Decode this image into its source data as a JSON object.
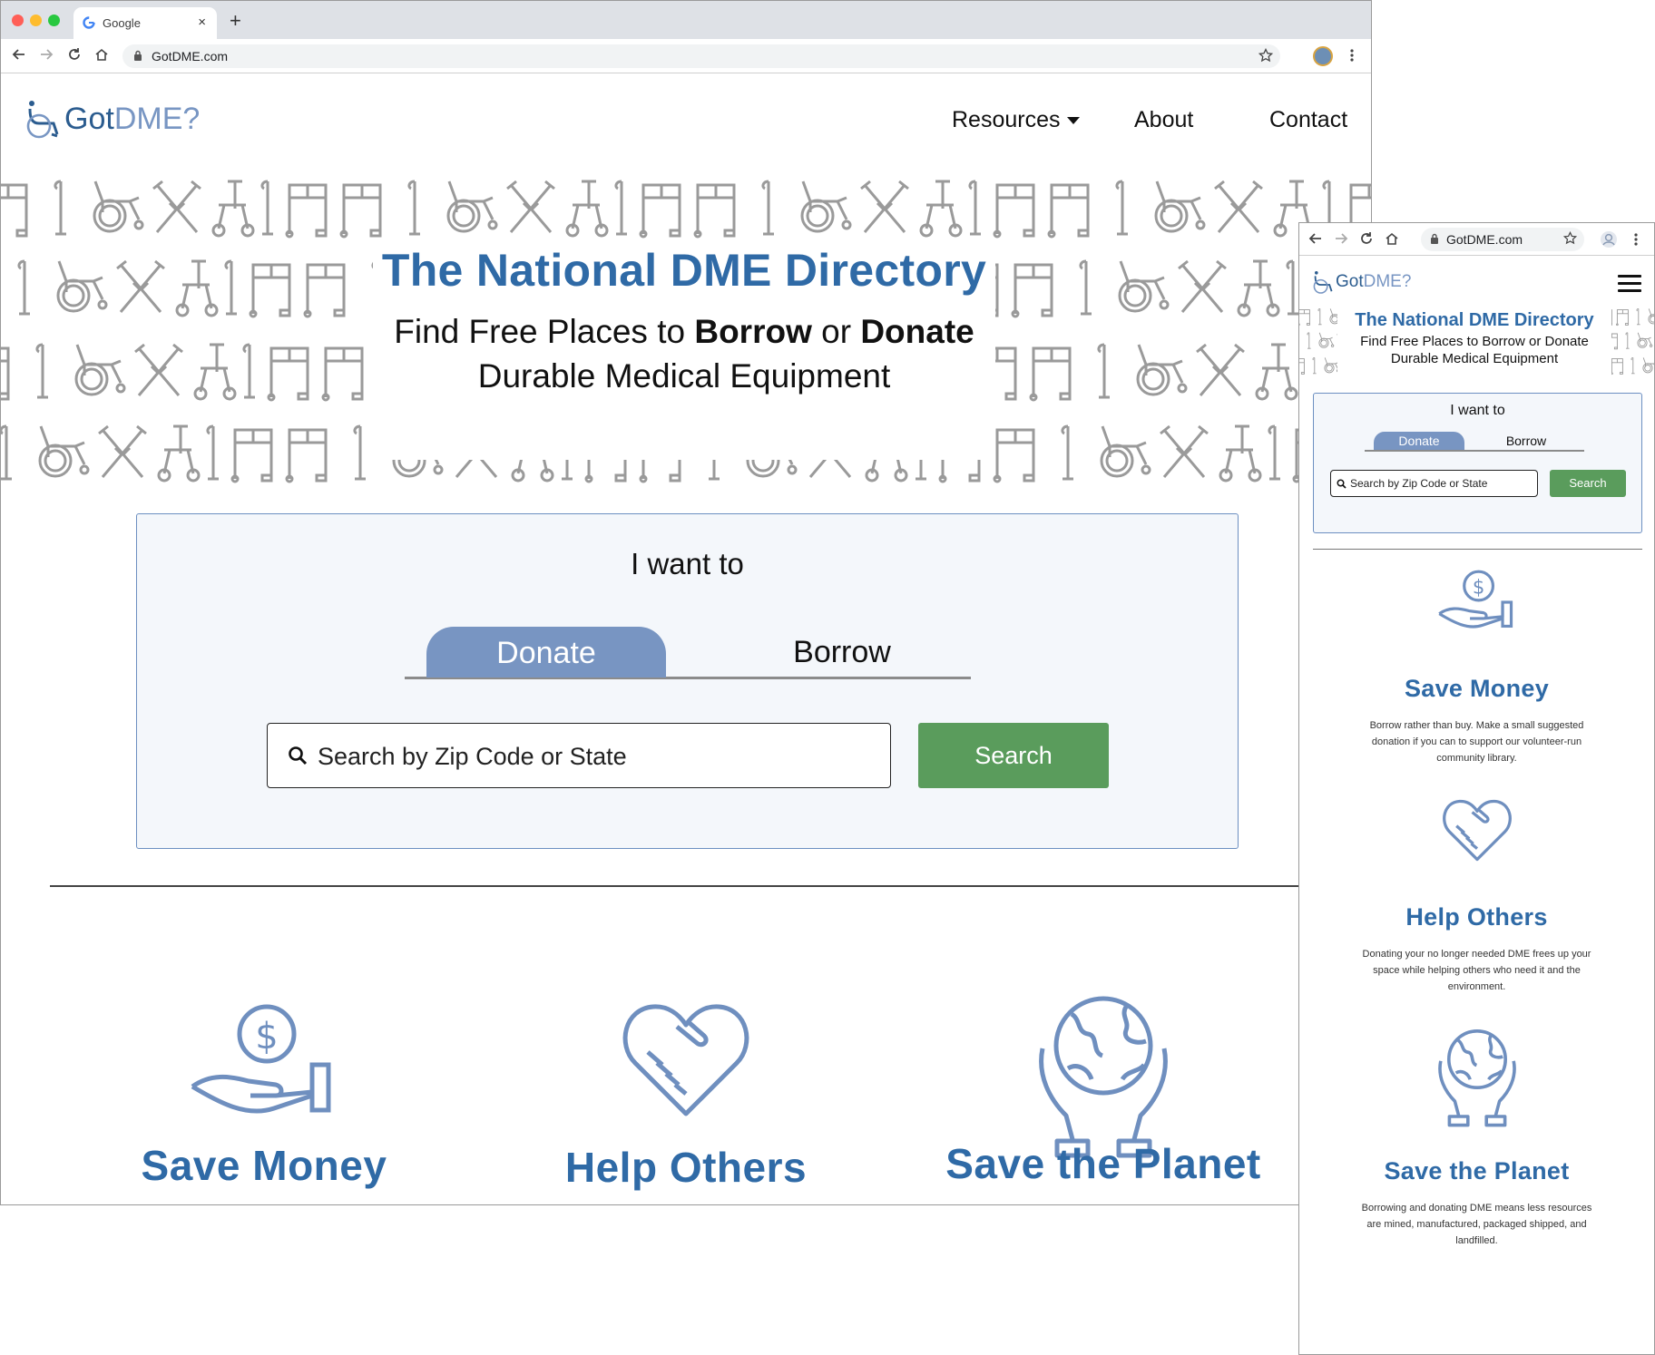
{
  "desktop": {
    "tab_title": "Google",
    "new_tab_label": "+",
    "tab_close_label": "×",
    "url": "GotDME.com",
    "logo": {
      "got": "Got",
      "dme": "DME?"
    },
    "nav": {
      "resources": "Resources",
      "about": "About",
      "contact": "Contact"
    },
    "title": "The National DME Directory",
    "subtitle": {
      "part1": "Find Free Places to ",
      "borrow": "Borrow",
      "or": " or ",
      "donate": "Donate",
      "line2": "Durable Medical Equipment"
    },
    "form": {
      "heading": "I want to",
      "tabs": {
        "donate": "Donate",
        "borrow": "Borrow"
      },
      "selected_tab": "Donate",
      "search_placeholder": "Search by Zip Code or State",
      "search_button": "Search"
    },
    "features": [
      {
        "label": "Save Money",
        "icon": "hand-coin-icon"
      },
      {
        "label": "Help Others",
        "icon": "heart-handshake-icon"
      },
      {
        "label": "Save the Planet",
        "icon": "hands-globe-icon"
      }
    ]
  },
  "mobile": {
    "url": "GotDME.com",
    "logo": {
      "got": "Got",
      "dme": "DME?"
    },
    "title": "The National DME Directory",
    "subtitle": {
      "line1": "Find Free Places to Borrow or Donate",
      "line2": "Durable Medical Equipment"
    },
    "form": {
      "heading": "I want to",
      "tabs": {
        "donate": "Donate",
        "borrow": "Borrow"
      },
      "search_placeholder": "Search by Zip Code or State",
      "search_button": "Search"
    },
    "features": [
      {
        "label": "Save Money",
        "desc": "Borrow rather than buy.  Make a small suggested donation if you can to support our volunteer-run community library."
      },
      {
        "label": "Help Others",
        "desc": "Donating  your no longer needed DME frees up your space while helping others who need it and the environment."
      },
      {
        "label": "Save the Planet",
        "desc": "Borrowing and donating DME means less resources are mined, manufactured, packaged shipped, and landfilled."
      }
    ]
  },
  "colors": {
    "brand_blue": "#2f6aa6",
    "accent_blue": "#7895c2",
    "search_green": "#5a9c5c",
    "form_bg": "#f4f7fb"
  }
}
